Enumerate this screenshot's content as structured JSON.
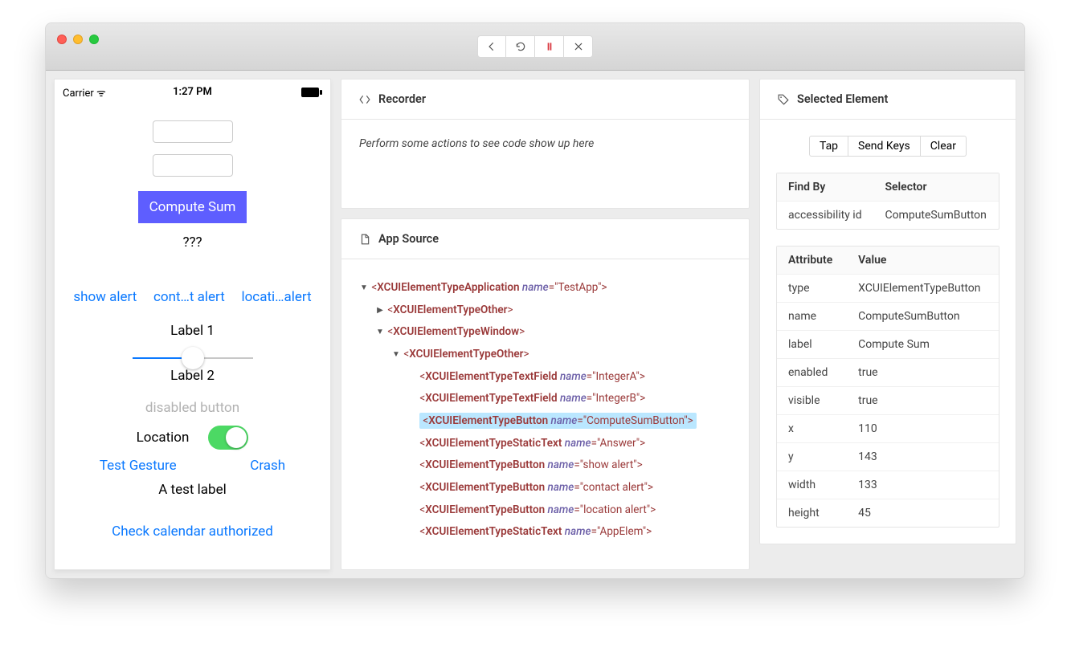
{
  "toolbar": {
    "back_title": "Back",
    "refresh_title": "Refresh",
    "pause_title": "Pause",
    "close_title": "Close"
  },
  "device": {
    "carrier": "Carrier",
    "wifi_glyph": "ᯤ",
    "time": "1:27 PM",
    "battery_glyph": "■▮",
    "compute_label": "Compute Sum",
    "answer": "???",
    "show_alert": "show alert",
    "contact_alert": "cont…t alert",
    "location_alert": "locati…alert",
    "label1": "Label 1",
    "label2": "Label 2",
    "disabled_button": "disabled button",
    "location_label": "Location",
    "test_gesture": "Test Gesture",
    "crash": "Crash",
    "test_label": "A test label",
    "calendar_link": "Check calendar authorized"
  },
  "recorder": {
    "title": "Recorder",
    "placeholder": "Perform some actions to see code show up here"
  },
  "source": {
    "title": "App Source",
    "tree": [
      {
        "indent": 0,
        "caret": "down",
        "el": "XCUIElementTypeApplication",
        "attr": "name",
        "val": "TestApp",
        "selected": false
      },
      {
        "indent": 1,
        "caret": "right",
        "el": "XCUIElementTypeOther",
        "selected": false
      },
      {
        "indent": 1,
        "caret": "down",
        "el": "XCUIElementTypeWindow",
        "selected": false
      },
      {
        "indent": 2,
        "caret": "down",
        "el": "XCUIElementTypeOther",
        "selected": false
      },
      {
        "indent": 3,
        "caret": "none",
        "el": "XCUIElementTypeTextField",
        "attr": "name",
        "val": "IntegerA",
        "selected": false
      },
      {
        "indent": 3,
        "caret": "none",
        "el": "XCUIElementTypeTextField",
        "attr": "name",
        "val": "IntegerB",
        "selected": false
      },
      {
        "indent": 3,
        "caret": "none",
        "el": "XCUIElementTypeButton",
        "attr": "name",
        "val": "ComputeSumButton",
        "selected": true
      },
      {
        "indent": 3,
        "caret": "none",
        "el": "XCUIElementTypeStaticText",
        "attr": "name",
        "val": "Answer",
        "selected": false
      },
      {
        "indent": 3,
        "caret": "none",
        "el": "XCUIElementTypeButton",
        "attr": "name",
        "val": "show alert",
        "selected": false
      },
      {
        "indent": 3,
        "caret": "none",
        "el": "XCUIElementTypeButton",
        "attr": "name",
        "val": "contact alert",
        "selected": false
      },
      {
        "indent": 3,
        "caret": "none",
        "el": "XCUIElementTypeButton",
        "attr": "name",
        "val": "location alert",
        "selected": false
      },
      {
        "indent": 3,
        "caret": "none",
        "el": "XCUIElementTypeStaticText",
        "attr": "name",
        "val": "AppElem",
        "selected": false
      }
    ]
  },
  "selected": {
    "title": "Selected Element",
    "buttons": {
      "tap": "Tap",
      "send_keys": "Send Keys",
      "clear": "Clear"
    },
    "findby": {
      "header_find": "Find By",
      "header_selector": "Selector",
      "row_find": "accessibility id",
      "row_selector": "ComputeSumButton"
    },
    "attributes": {
      "header_attr": "Attribute",
      "header_val": "Value",
      "rows": [
        {
          "k": "type",
          "v": "XCUIElementTypeButton"
        },
        {
          "k": "name",
          "v": "ComputeSumButton"
        },
        {
          "k": "label",
          "v": "Compute Sum"
        },
        {
          "k": "enabled",
          "v": "true"
        },
        {
          "k": "visible",
          "v": "true"
        },
        {
          "k": "x",
          "v": "110"
        },
        {
          "k": "y",
          "v": "143"
        },
        {
          "k": "width",
          "v": "133"
        },
        {
          "k": "height",
          "v": "45"
        }
      ]
    }
  }
}
